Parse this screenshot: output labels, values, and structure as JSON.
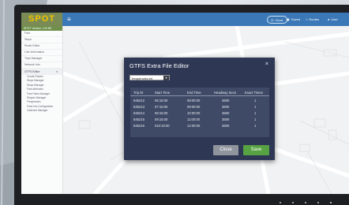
{
  "app": {
    "logo": "SPOT",
    "menu_glyph": "≡"
  },
  "topbar": {
    "buttons": [
      {
        "icon": "clock-icon",
        "label": "Clock",
        "glyph": "◷"
      },
      {
        "icon": "save-icon",
        "label": "Saved",
        "glyph": "▣"
      },
      {
        "icon": "home-icon",
        "label": "Routes",
        "glyph": "⌂"
      },
      {
        "icon": "user-icon",
        "label": "User",
        "glyph": "●"
      }
    ]
  },
  "sidebar": {
    "version": "SPOT Version 1.00 BE",
    "items": [
      "Fare",
      "Stops",
      "Route Editor",
      "Line Information",
      "Trips Manager",
      "Network Info"
    ],
    "section": "GTFS Editor",
    "section_caret": "∨",
    "subitems": [
      "Create Routes",
      "Stops Manager",
      "Stops Manager",
      "Fare Attributes",
      "Fare Rules Manager",
      "Shapes Manager",
      "Frequencies",
      "Feed Info Configuration",
      "Calendar Manager"
    ]
  },
  "modal": {
    "title": "GTFS Extra File Editor",
    "close_glyph": "×",
    "select_value": "frequencies.txt",
    "select_arrow": "▾",
    "columns": [
      "Trip ID",
      "Start Time",
      "End Time",
      "Headway Secs",
      "Exact Times"
    ],
    "rows": [
      [
        "645212",
        "06:15:00",
        "08:00:00",
        "3600",
        "1"
      ],
      [
        "645213",
        "07:15:00",
        "09:00:00",
        "3600",
        "1"
      ],
      [
        "645214",
        "08:15:00",
        "10:00:00",
        "3600",
        "1"
      ],
      [
        "645215",
        "09:15:00",
        "11:00:00",
        "3600",
        "1"
      ],
      [
        "645216",
        "010:15:00",
        "12:00:00",
        "3600",
        "1"
      ]
    ],
    "close_label": "Close",
    "save_label": "Save"
  },
  "colors": {
    "topbar": "#3b78b7",
    "logo_bg": "#7a8b55",
    "logo_text": "#f2c200",
    "modal_bg": "#2e3754",
    "table_bg": "#3f4a66",
    "save": "#57a242",
    "close": "#8f949d"
  }
}
